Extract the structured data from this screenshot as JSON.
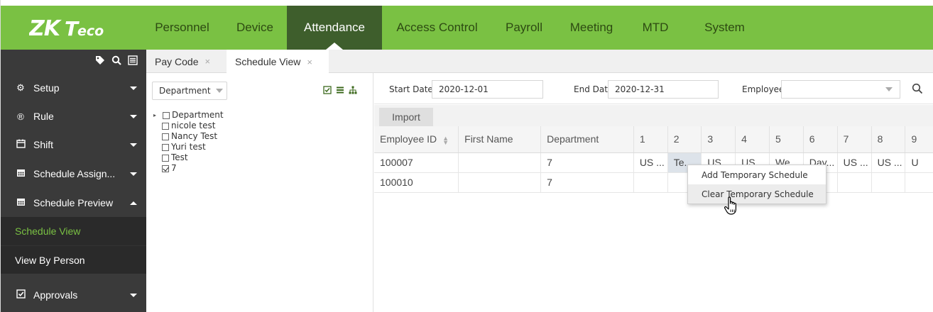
{
  "app": {
    "logo_text": "ZKTeco",
    "nav": [
      {
        "label": "Personnel",
        "active": false
      },
      {
        "label": "Device",
        "active": false
      },
      {
        "label": "Attendance",
        "active": true
      },
      {
        "label": "Access Control",
        "active": false
      },
      {
        "label": "Payroll",
        "active": false
      },
      {
        "label": "Meeting",
        "active": false
      },
      {
        "label": "MTD",
        "active": false
      },
      {
        "label": "System",
        "active": false
      }
    ],
    "colors": {
      "brand": "#7ac143",
      "nav_active": "#3e5e2c",
      "sidebar": "#3a3a3a",
      "sidebar_sub": "#2a2a2a",
      "link_active": "#7ac143"
    }
  },
  "sidebar": {
    "tools": [
      "tag-icon",
      "search-icon",
      "list-icon"
    ],
    "items": [
      {
        "label": "Setup",
        "icon": "gear-icon",
        "expanded": false
      },
      {
        "label": "Rule",
        "icon": "registered-icon",
        "expanded": false
      },
      {
        "label": "Shift",
        "icon": "calendar-icon",
        "expanded": false
      },
      {
        "label": "Schedule Assign...",
        "icon": "calendar-grid-icon",
        "expanded": false
      },
      {
        "label": "Schedule Preview",
        "icon": "calendar-grid-icon",
        "expanded": true
      },
      {
        "label": "Approvals",
        "icon": "check-square-icon",
        "expanded": false
      }
    ],
    "sub_items": [
      {
        "label": "Schedule View",
        "active": true
      },
      {
        "label": "View By Person",
        "active": false
      }
    ]
  },
  "tabs": [
    {
      "label": "Pay Code",
      "close": "×",
      "active": false
    },
    {
      "label": "Schedule View",
      "close": "×",
      "active": true
    }
  ],
  "dept_panel": {
    "select_value": "Department",
    "tree": [
      {
        "label": "Department",
        "checked": false,
        "level": 0,
        "toggle": "▸"
      },
      {
        "label": "nicole test",
        "checked": false,
        "level": 1
      },
      {
        "label": "Nancy Test",
        "checked": false,
        "level": 1
      },
      {
        "label": "Yuri test",
        "checked": false,
        "level": 1
      },
      {
        "label": "Test",
        "checked": false,
        "level": 1
      },
      {
        "label": "7",
        "checked": true,
        "level": 1
      }
    ]
  },
  "filters": {
    "start_date_label": "Start Date",
    "start_date": "2020-12-01",
    "end_date_label": "End Date",
    "end_date": "2020-12-31",
    "employee_label": "Employee",
    "employee_value": ""
  },
  "import_label": "Import",
  "grid": {
    "columns": [
      "Employee ID",
      "First Name",
      "Department",
      "1",
      "2",
      "3",
      "4",
      "5",
      "6",
      "7",
      "8",
      "9"
    ],
    "rows": [
      [
        "100007",
        "",
        "7",
        "US ...",
        "Te...",
        "US...",
        "US...",
        "We...",
        "Day...",
        "US ...",
        "US ...",
        "U"
      ],
      [
        "100010",
        "",
        "7",
        "",
        "",
        "",
        "",
        "",
        "",
        "",
        "",
        ""
      ]
    ]
  },
  "context_menu": {
    "items": [
      {
        "label": "Add Temporary Schedule",
        "hover": false
      },
      {
        "label": "Clear Temporary Schedule",
        "hover": true
      }
    ]
  }
}
